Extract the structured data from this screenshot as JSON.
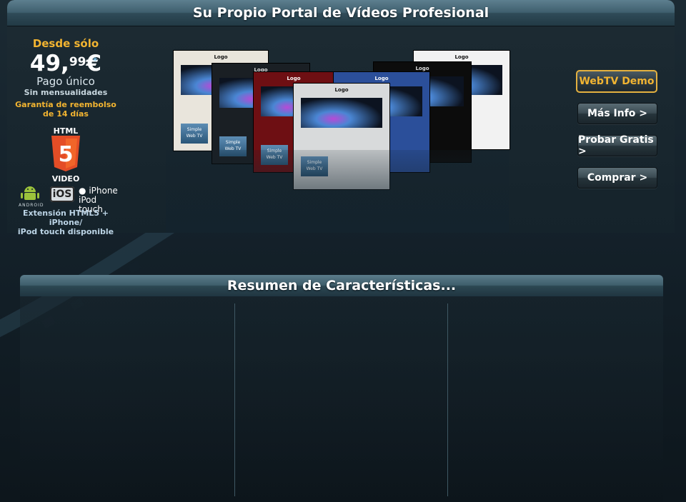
{
  "header": {
    "title": "Su Propio Portal de Vídeos Profesional"
  },
  "promo": {
    "desde": "Desde sólo",
    "price_main": "49,",
    "price_cents": "99",
    "price_currency": "€",
    "price_mark": "*",
    "pago": "Pago único",
    "sin_mensualidades": "Sin mensualidades",
    "garantia_line1": "Garantía de reembolso",
    "garantia_line2": "de 14 días",
    "html5_label": "HTML",
    "html5_number": "5",
    "video_label": "VIDEO",
    "android_label": "ANDROID",
    "ios_label": "iOS",
    "iphone_label": "iPhone",
    "ipod_label": "iPod touch",
    "extension_line1": "Extensión HTML5 + iPhone/",
    "extension_line2": "iPod touch disponible"
  },
  "collage": {
    "logo_text": "Logo",
    "button_text_1": "Simple",
    "button_text_2": "Web TV"
  },
  "actions": {
    "demo": "WebTV Demo",
    "info": "Más Info >",
    "trial": "Probar Gratis >",
    "buy": "Comprar >"
  },
  "features": {
    "title": "Resumen de Características..."
  },
  "colors": {
    "accent": "#f2b431",
    "bar": "#3e5e6b",
    "background": "#14212a"
  }
}
